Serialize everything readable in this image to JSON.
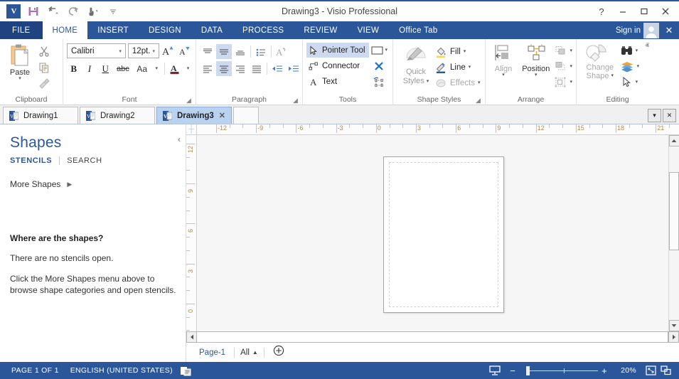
{
  "window": {
    "title": "Drawing3 - Visio Professional",
    "logo_text": "V",
    "help_label": "?",
    "minimize_label": "—",
    "maximize_label": "□",
    "close_label": "✕",
    "qat": [
      {
        "name": "save-icon",
        "label": "Save"
      },
      {
        "name": "undo-icon",
        "label": "Undo"
      },
      {
        "name": "redo-icon",
        "label": "Redo"
      },
      {
        "name": "touch-mode-icon",
        "label": "Touch/Mouse Mode"
      },
      {
        "name": "customize-qat-icon",
        "label": "Customize Quick Access Toolbar"
      }
    ]
  },
  "ribbon_tabs": {
    "items": [
      {
        "label": "FILE",
        "active": false
      },
      {
        "label": "HOME",
        "active": true
      },
      {
        "label": "INSERT",
        "active": false
      },
      {
        "label": "DESIGN",
        "active": false
      },
      {
        "label": "DATA",
        "active": false
      },
      {
        "label": "PROCESS",
        "active": false
      },
      {
        "label": "REVIEW",
        "active": false
      },
      {
        "label": "VIEW",
        "active": false
      },
      {
        "label": "Office Tab",
        "active": false
      }
    ],
    "sign_in": "Sign in",
    "close_ribbon": "✕"
  },
  "ribbon": {
    "clipboard": {
      "group_label": "Clipboard",
      "paste_label": "Paste",
      "paste_caret": "▾",
      "cut_label": "Cut",
      "copy_label": "Copy",
      "format_painter_label": "Format Painter"
    },
    "font": {
      "group_label": "Font",
      "font_name": "Calibri",
      "font_size": "12pt.",
      "grow_font": "A",
      "shrink_font": "A",
      "bold": "B",
      "italic": "I",
      "underline": "U",
      "strikethrough": "abc",
      "change_case": "Aa",
      "font_color": "A",
      "caret": "▾",
      "dialog_launcher": "◢"
    },
    "paragraph": {
      "group_label": "Paragraph",
      "dialog_launcher": "◢",
      "align_top": "align-top",
      "align_middle": "align-middle",
      "align_bottom": "align-bottom",
      "bullets": "bullets",
      "text_direction": "text-direction",
      "align_left": "align-left",
      "align_center": "align-center",
      "align_right": "align-right",
      "justify": "justify",
      "decrease_indent": "decrease-indent",
      "increase_indent": "increase-indent"
    },
    "tools": {
      "group_label": "Tools",
      "pointer_tool": "Pointer Tool",
      "connector": "Connector",
      "text": "Text",
      "shapes_caret": "▾",
      "delete_label": "✕",
      "pointer_tool_selected": true
    },
    "shape_styles": {
      "group_label": "Shape Styles",
      "quick_styles_line1": "Quick",
      "quick_styles_line2": "Styles",
      "quick_styles_caret": "▾",
      "fill": "Fill",
      "line": "Line",
      "effects": "Effects",
      "caret": "▾",
      "dialog_launcher": "◢"
    },
    "arrange": {
      "group_label": "Arrange",
      "align": "Align",
      "position": "Position",
      "caret": "▾",
      "bring_to_front": "bring-to-front",
      "send_to_back": "send-to-back",
      "group_shapes": "group"
    },
    "editing": {
      "group_label": "Editing",
      "change_shape_line1": "Change",
      "change_shape_line2": "Shape",
      "find": "Find",
      "layers": "Layers",
      "select": "Select",
      "caret": "▾"
    },
    "collapse_caret": "ⱏ"
  },
  "doc_tabs": {
    "items": [
      {
        "label": "Drawing1",
        "active": false,
        "closable": false
      },
      {
        "label": "Drawing2",
        "active": false,
        "closable": false
      },
      {
        "label": "Drawing3",
        "active": true,
        "closable": true,
        "close_label": "✕"
      }
    ],
    "menu_label": "▾",
    "close_label": "✕"
  },
  "shapes_panel": {
    "title": "Shapes",
    "tab_stencils": "STENCILS",
    "tab_search": "SEARCH",
    "more_shapes": "More Shapes",
    "more_shapes_arrow": "▶",
    "collapse_arrow": "‹",
    "help_heading": "Where are the shapes?",
    "help_line1": "There are no stencils open.",
    "help_line2": "Click the More Shapes menu above to browse shape categories and open stencils."
  },
  "rulers": {
    "h_labels": [
      "-12",
      "-9",
      "-6",
      "-3",
      "0",
      "3",
      "6",
      "9",
      "12",
      "15",
      "18",
      "21"
    ],
    "v_labels": [
      "12",
      "9",
      "6",
      "3",
      "0"
    ],
    "corner_glyph": "┼"
  },
  "scrollbars": {
    "up_arrow": "▲",
    "down_arrow": "▼",
    "left_arrow": "◀",
    "right_arrow": "▶"
  },
  "page_nav": {
    "page_name": "Page-1",
    "all_label": "All",
    "all_caret": "▲",
    "add_page": "⊕"
  },
  "status_bar": {
    "page_count": "PAGE 1 OF 1",
    "language": "ENGLISH (UNITED STATES)",
    "macro_icon": "macro-record-icon",
    "presentation_icon": "presentation-mode-icon",
    "zoom_out": "−",
    "zoom_in": "+",
    "zoom_level": "20%",
    "fit_page_icon": "fit-page-icon",
    "fit_window_icon": "fit-window-icon"
  }
}
